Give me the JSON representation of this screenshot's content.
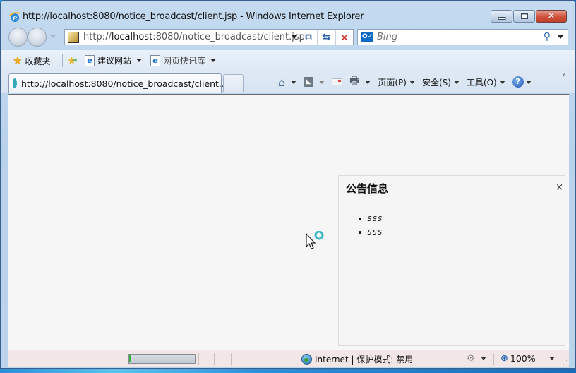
{
  "window": {
    "title": "http://localhost:8080/notice_broadcast/client.jsp - Windows Internet Explorer",
    "buttons": {
      "minimize": "minimize",
      "restore": "restore",
      "close": "✕"
    }
  },
  "navigation": {
    "address_prefix": "http://",
    "address_host": "localhost",
    "address_rest": ":8080/notice_broadcast/client.jsp",
    "search_placeholder": "Bing",
    "search_provider_icon": "O✓",
    "search_go_glyph": "⚲",
    "compat_glyph": "⧉",
    "refresh_glyph": "⇆",
    "stop_glyph": "✕"
  },
  "favorites_bar": {
    "favorites_label": "收藏夹",
    "items": [
      {
        "label": "建议网站",
        "has_dropdown": true
      },
      {
        "label": "网页快讯库",
        "has_dropdown": true
      }
    ]
  },
  "tabs": [
    {
      "label": "http://localhost:8080/notice_broadcast/client...",
      "active": true,
      "loading": true
    }
  ],
  "command_bar": {
    "home_glyph": "⌂",
    "rss_glyph": "◣",
    "print_glyph": "🖶",
    "page_label": "页面(P)",
    "safety_label": "安全(S)",
    "tools_label": "工具(O)",
    "help_glyph": "?",
    "more_glyph": "»"
  },
  "notice_panel": {
    "title": "公告信息",
    "close_glyph": "×",
    "items": [
      "sss",
      "sss"
    ]
  },
  "status_bar": {
    "zone_text": "Internet | 保护模式: 禁用",
    "zoom_glyph": "⊕",
    "zoom_level": "100%",
    "security_glyph": "⚙",
    "grip_glyph": "⋰"
  },
  "colors": {
    "window_frame": "#bcd3ec",
    "content_bg": "#f6f6f6",
    "panel_bg": "#f5f5f5",
    "close_button": "#c2402a",
    "status_bg": "#f2e6e6"
  }
}
